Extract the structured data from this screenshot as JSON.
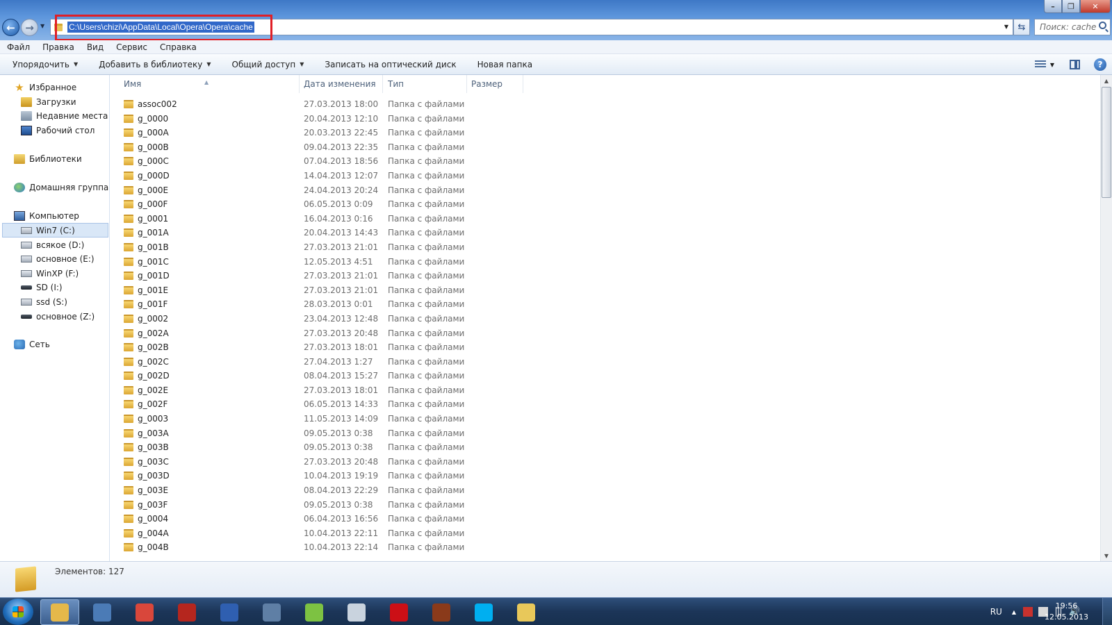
{
  "address": {
    "path": "C:\\Users\\chizi\\AppData\\Local\\Opera\\Opera\\cache"
  },
  "search": {
    "placeholder": "Поиск: cache"
  },
  "menu": [
    "Файл",
    "Правка",
    "Вид",
    "Сервис",
    "Справка"
  ],
  "commands": {
    "organize": "Упорядочить",
    "add_library": "Добавить в библиотеку",
    "share": "Общий доступ",
    "burn": "Записать на оптический диск",
    "new_folder": "Новая папка"
  },
  "nav": {
    "favorites": "Избранное",
    "downloads": "Загрузки",
    "recent": "Недавние места",
    "desktop": "Рабочий стол",
    "libraries": "Библиотеки",
    "homegroup": "Домашняя группа",
    "computer": "Компьютер",
    "drives": [
      "Win7 (C:)",
      "всякое (D:)",
      "основное (E:)",
      "WinXP (F:)",
      "SD (I:)",
      "ssd (S:)",
      "основное (Z:)"
    ],
    "network": "Сеть"
  },
  "columns": {
    "name": "Имя",
    "date": "Дата изменения",
    "type": "Тип",
    "size": "Размер"
  },
  "files": [
    {
      "name": "assoc002",
      "date": "27.03.2013 18:00",
      "type": "Папка с файлами"
    },
    {
      "name": "g_0000",
      "date": "20.04.2013 12:10",
      "type": "Папка с файлами"
    },
    {
      "name": "g_000A",
      "date": "20.03.2013 22:45",
      "type": "Папка с файлами"
    },
    {
      "name": "g_000B",
      "date": "09.04.2013 22:35",
      "type": "Папка с файлами"
    },
    {
      "name": "g_000C",
      "date": "07.04.2013 18:56",
      "type": "Папка с файлами"
    },
    {
      "name": "g_000D",
      "date": "14.04.2013 12:07",
      "type": "Папка с файлами"
    },
    {
      "name": "g_000E",
      "date": "24.04.2013 20:24",
      "type": "Папка с файлами"
    },
    {
      "name": "g_000F",
      "date": "06.05.2013 0:09",
      "type": "Папка с файлами"
    },
    {
      "name": "g_0001",
      "date": "16.04.2013 0:16",
      "type": "Папка с файлами"
    },
    {
      "name": "g_001A",
      "date": "20.04.2013 14:43",
      "type": "Папка с файлами"
    },
    {
      "name": "g_001B",
      "date": "27.03.2013 21:01",
      "type": "Папка с файлами"
    },
    {
      "name": "g_001C",
      "date": "12.05.2013 4:51",
      "type": "Папка с файлами"
    },
    {
      "name": "g_001D",
      "date": "27.03.2013 21:01",
      "type": "Папка с файлами"
    },
    {
      "name": "g_001E",
      "date": "27.03.2013 21:01",
      "type": "Папка с файлами"
    },
    {
      "name": "g_001F",
      "date": "28.03.2013 0:01",
      "type": "Папка с файлами"
    },
    {
      "name": "g_0002",
      "date": "23.04.2013 12:48",
      "type": "Папка с файлами"
    },
    {
      "name": "g_002A",
      "date": "27.03.2013 20:48",
      "type": "Папка с файлами"
    },
    {
      "name": "g_002B",
      "date": "27.03.2013 18:01",
      "type": "Папка с файлами"
    },
    {
      "name": "g_002C",
      "date": "27.04.2013 1:27",
      "type": "Папка с файлами"
    },
    {
      "name": "g_002D",
      "date": "08.04.2013 15:27",
      "type": "Папка с файлами"
    },
    {
      "name": "g_002E",
      "date": "27.03.2013 18:01",
      "type": "Папка с файлами"
    },
    {
      "name": "g_002F",
      "date": "06.05.2013 14:33",
      "type": "Папка с файлами"
    },
    {
      "name": "g_0003",
      "date": "11.05.2013 14:09",
      "type": "Папка с файлами"
    },
    {
      "name": "g_003A",
      "date": "09.05.2013 0:38",
      "type": "Папка с файлами"
    },
    {
      "name": "g_003B",
      "date": "09.05.2013 0:38",
      "type": "Папка с файлами"
    },
    {
      "name": "g_003C",
      "date": "27.03.2013 20:48",
      "type": "Папка с файлами"
    },
    {
      "name": "g_003D",
      "date": "10.04.2013 19:19",
      "type": "Папка с файлами"
    },
    {
      "name": "g_003E",
      "date": "08.04.2013 22:29",
      "type": "Папка с файлами"
    },
    {
      "name": "g_003F",
      "date": "09.05.2013 0:38",
      "type": "Папка с файлами"
    },
    {
      "name": "g_0004",
      "date": "06.04.2013 16:56",
      "type": "Папка с файлами"
    },
    {
      "name": "g_004A",
      "date": "10.04.2013 22:11",
      "type": "Папка с файлами"
    },
    {
      "name": "g_004B",
      "date": "10.04.2013 22:14",
      "type": "Папка с файлами"
    }
  ],
  "details": {
    "count": "Элементов: 127"
  },
  "taskbar": {
    "apps": [
      {
        "icon": "explorer-icon",
        "color": "#e5b84a",
        "active": true
      },
      {
        "icon": "computer-icon",
        "color": "#4b7bb6"
      },
      {
        "icon": "chrome-icon",
        "color": "#d9473b"
      },
      {
        "icon": "filezilla-icon",
        "color": "#b5261e"
      },
      {
        "icon": "save-icon",
        "color": "#2f5fb0"
      },
      {
        "icon": "kmplayer-icon",
        "color": "#5f7fa5"
      },
      {
        "icon": "media-player-icon",
        "color": "#7dc242"
      },
      {
        "icon": "calculator-icon",
        "color": "#c9d3de"
      },
      {
        "icon": "opera-icon",
        "color": "#cc0f16"
      },
      {
        "icon": "game-icon",
        "color": "#8a3a1a"
      },
      {
        "icon": "skype-icon",
        "color": "#00aff0"
      },
      {
        "icon": "paint-icon",
        "color": "#e8c85a"
      }
    ],
    "lang": "RU",
    "time": "19:56",
    "date": "12.05.2013"
  }
}
